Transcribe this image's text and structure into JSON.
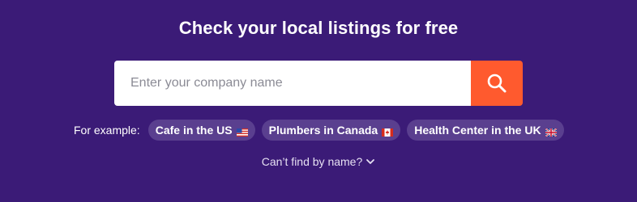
{
  "header": {
    "title": "Check your local listings for free"
  },
  "search": {
    "placeholder": "Enter your company name",
    "value": "",
    "button_icon": "search-icon"
  },
  "examples": {
    "label": "For example:",
    "chips": [
      {
        "label": "Cafe in the US",
        "flag_icon": "us-flag-icon"
      },
      {
        "label": "Plumbers in Canada",
        "flag_icon": "canada-flag-icon"
      },
      {
        "label": "Health Center in the UK",
        "flag_icon": "uk-flag-icon"
      }
    ]
  },
  "cant_find": {
    "label": "Can’t find by name?",
    "icon": "chevron-down-icon"
  },
  "colors": {
    "background": "#3b1b77",
    "accent": "#ff5a2e",
    "chip_background": "#5a3f8f"
  }
}
